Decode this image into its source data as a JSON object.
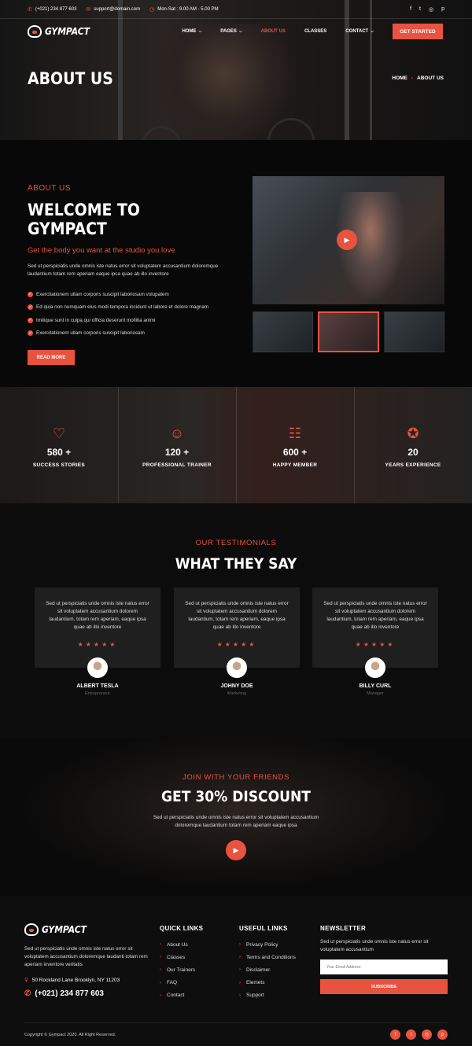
{
  "topbar": {
    "phone": "(+021) 234 877 603",
    "email": "support@domain.com",
    "hours": "Mon-Sat : 9.00 AM - 5.00 PM",
    "social_icons": [
      "facebook-icon",
      "twitter-icon",
      "instagram-icon",
      "pinterest-icon"
    ]
  },
  "brand": {
    "name": "GYMPACT"
  },
  "nav": {
    "items": [
      {
        "label": "HOME",
        "has_dropdown": true
      },
      {
        "label": "PAGES",
        "has_dropdown": true
      },
      {
        "label": "ABOUT US",
        "active": true
      },
      {
        "label": "CLASSES"
      },
      {
        "label": "CONTACT",
        "has_dropdown": true
      }
    ],
    "cta": "GET STARTED"
  },
  "hero": {
    "title": "ABOUT US",
    "breadcrumb": [
      "HOME",
      "ABOUT US"
    ]
  },
  "about": {
    "eyebrow": "ABOUT US",
    "title": "WELCOME TO GYMPACT",
    "subtitle": "Get the body you want at the studio you love",
    "text": "Sed ut perspiciatis unde omnis iste natus error sit voluptatem accusantium doloremque laudantium totam rem aperiam eaque ipsa quae ab illo inventore",
    "checks": [
      "Exercitationem ullam corporis suscipit laboriosam volupatem",
      "Ed quia non numquam eius modi tempora incidunt ut labore et dolore magnam",
      "Imilique sunt in culpa qui officia deserunt mollitia animi",
      "Exercitationem ullam corporis suscipit laboriosam"
    ],
    "button": "READ MORE"
  },
  "stats": [
    {
      "icon": "heart-icon",
      "number": "580 +",
      "label": "SUCCESS STORIES"
    },
    {
      "icon": "trainer-icon",
      "number": "120 +",
      "label": "PROFESSIONAL TRAINER"
    },
    {
      "icon": "group-icon",
      "number": "600 +",
      "label": "HAPPY MEMBER"
    },
    {
      "icon": "award-icon",
      "number": "20",
      "label": "YEARS EXPERIENCE"
    }
  ],
  "testimonials": {
    "eyebrow": "OUR TESTIMONIALS",
    "title": "WHAT THEY SAY",
    "items": [
      {
        "text": "Sed ut perspiciatis unde omnis iste natus error sit voluptatem accusantium dolorem laudantium, totam rem aperiam, eaque ipsa quae ab illo inventore",
        "rating": 5,
        "name": "ALBERT TESLA",
        "role": "Entrepreneur"
      },
      {
        "text": "Sed ut perspiciatis unde omnis iste natus error sit voluptatem accusantium dolorem laudantium, totam rem aperiam, eaque ipsa quae ab illo inventore",
        "rating": 5,
        "name": "JOHNY DOE",
        "role": "Marketing"
      },
      {
        "text": "Sed ut perspiciatis unde omnis iste natus error sit voluptatem accusantium dolorem laudantium, totam rem aperiam, eaque ipsa quae ab illo inventore",
        "rating": 5,
        "name": "BILLY CURL",
        "role": "Manager"
      }
    ]
  },
  "promo": {
    "eyebrow": "JOIN WITH YOUR FRIENDS",
    "title": "GET 30% DISCOUNT",
    "text": "Sed ut perspiciatis unde omnis iste natus error sit voluptatem accusantium doloremque laudantium totam rem aperiam eaque ipsa"
  },
  "footer": {
    "about_text": "Sed ut perspiciatis unde omnis iste natus error sit voluptatem accusantium doloremque laudanti totam rem aperiam inventore veritatis",
    "address": "50 Rockland Lane Brooklyn, NY 11203",
    "phone": "(+021) 234 877 603",
    "quick_links": {
      "title": "QUICK LINKS",
      "items": [
        "About Us",
        "Classes",
        "Our Trainers",
        "FAQ",
        "Contact"
      ]
    },
    "useful_links": {
      "title": "USEFUL LINKS",
      "items": [
        "Privacy Policy",
        "Terms and Conditions",
        "Disclaimer",
        "Elemets",
        "Support"
      ]
    },
    "newsletter": {
      "title": "NEWSLETTER",
      "text": "Sed ut perspiciatis unde omnis iste natus error sit voluptatem accusantium",
      "placeholder": "Your Email Address",
      "button": "SUBSCRIBE"
    },
    "copyright": "Copyright © Gympact 2020. All Right Reserved.",
    "social_icons": [
      "facebook-icon",
      "twitter-icon",
      "instagram-icon",
      "pinterest-icon"
    ]
  },
  "colors": {
    "accent": "#e8533f",
    "background": "#0c0c0c",
    "card": "#1f1f1f"
  }
}
